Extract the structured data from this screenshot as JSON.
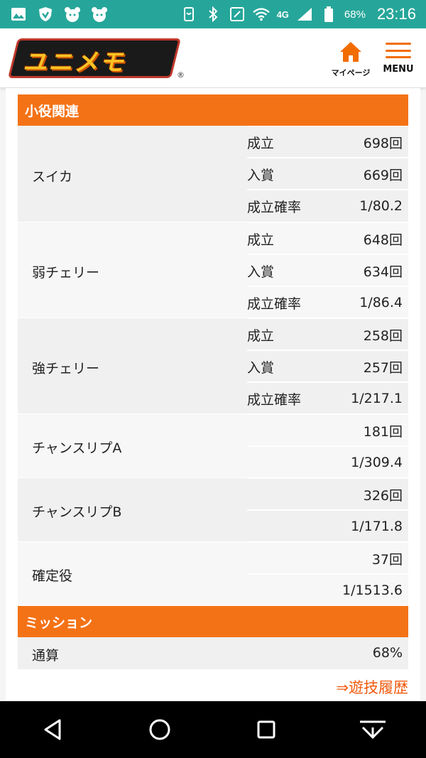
{
  "status_bar": {
    "network": "4G",
    "battery": "68%",
    "time": "23:16"
  },
  "header": {
    "logo_text": "ユニメモ",
    "logo_mark": "®",
    "mypage_label": "マイページ",
    "menu_label": "MENU",
    "accent_color": "#f47216"
  },
  "small_roles": {
    "title": "小役関連",
    "items": [
      {
        "name": "スイカ",
        "rows": [
          {
            "label": "成立",
            "value": "698回"
          },
          {
            "label": "入賞",
            "value": "669回"
          },
          {
            "label": "成立確率",
            "value": "1/80.2"
          }
        ]
      },
      {
        "name": "弱チェリー",
        "rows": [
          {
            "label": "成立",
            "value": "648回"
          },
          {
            "label": "入賞",
            "value": "634回"
          },
          {
            "label": "成立確率",
            "value": "1/86.4"
          }
        ]
      },
      {
        "name": "強チェリー",
        "rows": [
          {
            "label": "成立",
            "value": "258回"
          },
          {
            "label": "入賞",
            "value": "257回"
          },
          {
            "label": "成立確率",
            "value": "1/217.1"
          }
        ]
      },
      {
        "name": "チャンスリプA",
        "rows": [
          {
            "label": "",
            "value": "181回"
          },
          {
            "label": "",
            "value": "1/309.4"
          }
        ]
      },
      {
        "name": "チャンスリプB",
        "rows": [
          {
            "label": "",
            "value": "326回"
          },
          {
            "label": "",
            "value": "1/171.8"
          }
        ]
      },
      {
        "name": "確定役",
        "rows": [
          {
            "label": "",
            "value": "37回"
          },
          {
            "label": "",
            "value": "1/1513.6"
          }
        ]
      }
    ]
  },
  "mission": {
    "title": "ミッション",
    "label": "通算",
    "value": "68%"
  },
  "history_link": "⇒遊技履歴"
}
